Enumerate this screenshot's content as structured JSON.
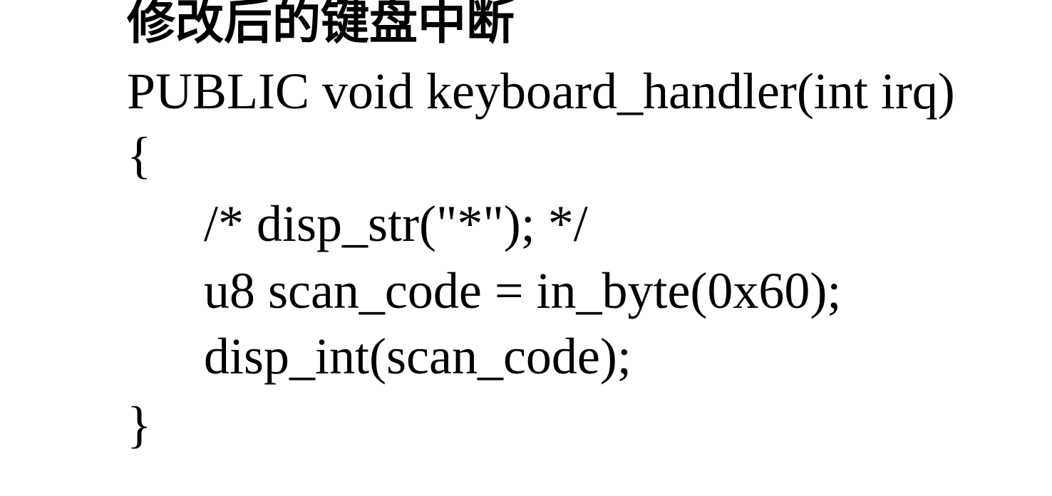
{
  "slide": {
    "heading": "修改后的键盘中断",
    "code_lines": [
      "PUBLIC void keyboard_handler(int irq)",
      "{",
      "/* disp_str(\"*\"); */",
      "u8 scan_code = in_byte(0x60);",
      "disp_int(scan_code);",
      "}"
    ]
  }
}
